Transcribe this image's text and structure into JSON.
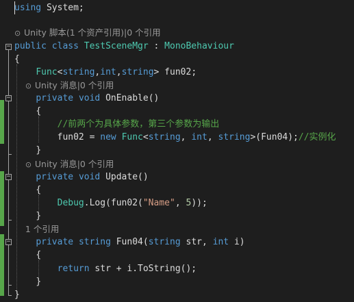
{
  "editor": {
    "using_keyword": "using",
    "using_rest": " System;",
    "class_lens": {
      "icon": "⊙",
      "text": "Unity 脚本(1 个资产引用)|0 个引用"
    },
    "class_decl": {
      "kw_public": "public",
      "kw_class": "class",
      "name": "TestSceneMgr",
      "sep": " : ",
      "base": "MonoBehaviour"
    },
    "brace_open": "{",
    "brace_close": "}",
    "field_decl": {
      "type": "Func",
      "lt": "<",
      "t1": "string",
      "c1": ",",
      "t2": "int",
      "c2": ",",
      "t3": "string",
      "gt": ">",
      "rest": " fun02;"
    },
    "onenable_lens": {
      "icon": "⊙",
      "text": "Unity 消息|0 个引用"
    },
    "onenable_decl": {
      "kw_private": "private",
      "kw_void": "void",
      "name": "OnEnable",
      "parens": "()"
    },
    "comment_line": "//前两个为具体参数，第三个参数为输出",
    "assign_line": {
      "lhs": "fun02 = ",
      "kw_new": "new",
      "type": "Func",
      "lt": "<",
      "t1": "string",
      "c1": ", ",
      "t2": "int",
      "c2": ", ",
      "t3": "string",
      "gt": ">",
      "args": "(Fun04);",
      "comment": "//实例化"
    },
    "update_lens": {
      "icon": "⊙",
      "text": "Unity 消息|0 个引用"
    },
    "update_decl": {
      "kw_private": "private",
      "kw_void": "void",
      "name": "Update",
      "parens": "()"
    },
    "debug_line": {
      "type": "Debug",
      "call": ".Log(fun02(",
      "string": "\"Name\"",
      "sep": ", ",
      "number": "5",
      "end": "));"
    },
    "fun04_lens": {
      "text": "1 个引用"
    },
    "fun04_decl": {
      "kw_private": "private",
      "kw_string": "string",
      "name": "Fun04",
      "open": "(",
      "kw_string2": "string",
      "p1": " str, ",
      "kw_int": "int",
      "p2": " i)"
    },
    "return_line": {
      "kw_return": "return",
      "rest": " str + i.ToString();"
    }
  },
  "colors": {
    "background": "#1e1e1e",
    "keyword": "#569cd6",
    "type": "#4ec9b0",
    "comment": "#57a64a",
    "string": "#d69d85",
    "number": "#b5cea8",
    "plain": "#dcdcdc",
    "codelens": "#999999",
    "change_bar": "#57a64a"
  }
}
